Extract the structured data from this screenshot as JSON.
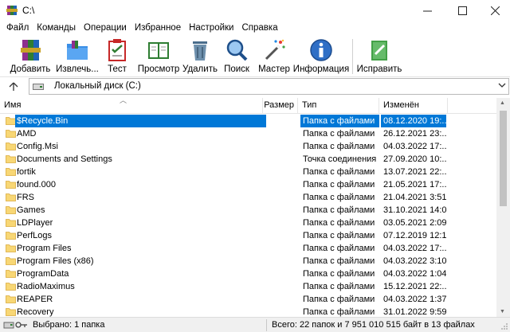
{
  "window": {
    "title": "C:\\"
  },
  "menu": [
    "Файл",
    "Команды",
    "Операции",
    "Избранное",
    "Настройки",
    "Справка"
  ],
  "toolbar": {
    "add": "Добавить",
    "extract": "Извлечь...",
    "test": "Тест",
    "view": "Просмотр",
    "delete": "Удалить",
    "find": "Поиск",
    "wizard": "Мастер",
    "info": "Информация",
    "repair": "Исправить"
  },
  "address": {
    "path": "Локальный диск (C:)"
  },
  "columns": {
    "name": "Имя",
    "size": "Размер",
    "type": "Тип",
    "modified": "Изменён"
  },
  "rows": [
    {
      "name": "$Recycle.Bin",
      "type": "Папка с файлами",
      "date": "08.12.2020 19:...",
      "selected": true
    },
    {
      "name": "AMD",
      "type": "Папка с файлами",
      "date": "26.12.2021 23:..."
    },
    {
      "name": "Config.Msi",
      "type": "Папка с файлами",
      "date": "04.03.2022 17:..."
    },
    {
      "name": "Documents and Settings",
      "type": "Точка соединения",
      "date": "27.09.2020 10:..."
    },
    {
      "name": "fortik",
      "type": "Папка с файлами",
      "date": "13.07.2021 22:..."
    },
    {
      "name": "found.000",
      "type": "Папка с файлами",
      "date": "21.05.2021 17:..."
    },
    {
      "name": "FRS",
      "type": "Папка с файлами",
      "date": "21.04.2021 3:51"
    },
    {
      "name": "Games",
      "type": "Папка с файлами",
      "date": "31.10.2021 14:07"
    },
    {
      "name": "LDPlayer",
      "type": "Папка с файлами",
      "date": "03.05.2021 2:09"
    },
    {
      "name": "PerfLogs",
      "type": "Папка с файлами",
      "date": "07.12.2019 12:14"
    },
    {
      "name": "Program Files",
      "type": "Папка с файлами",
      "date": "04.03.2022 17:..."
    },
    {
      "name": "Program Files (x86)",
      "type": "Папка с файлами",
      "date": "04.03.2022 3:10"
    },
    {
      "name": "ProgramData",
      "type": "Папка с файлами",
      "date": "04.03.2022 1:04"
    },
    {
      "name": "RadioMaximus",
      "type": "Папка с файлами",
      "date": "15.12.2021 22:..."
    },
    {
      "name": "REAPER",
      "type": "Папка с файлами",
      "date": "04.03.2022 1:37"
    },
    {
      "name": "Recovery",
      "type": "Папка с файлами",
      "date": "31.01.2022 9:59"
    }
  ],
  "status": {
    "left": "Выбрано: 1 папка",
    "right": "Всего: 22 папок и 7 951 010 515 байт в 13 файлах"
  },
  "colors": {
    "selection": "#0078d7",
    "folder": "#f8d775"
  }
}
